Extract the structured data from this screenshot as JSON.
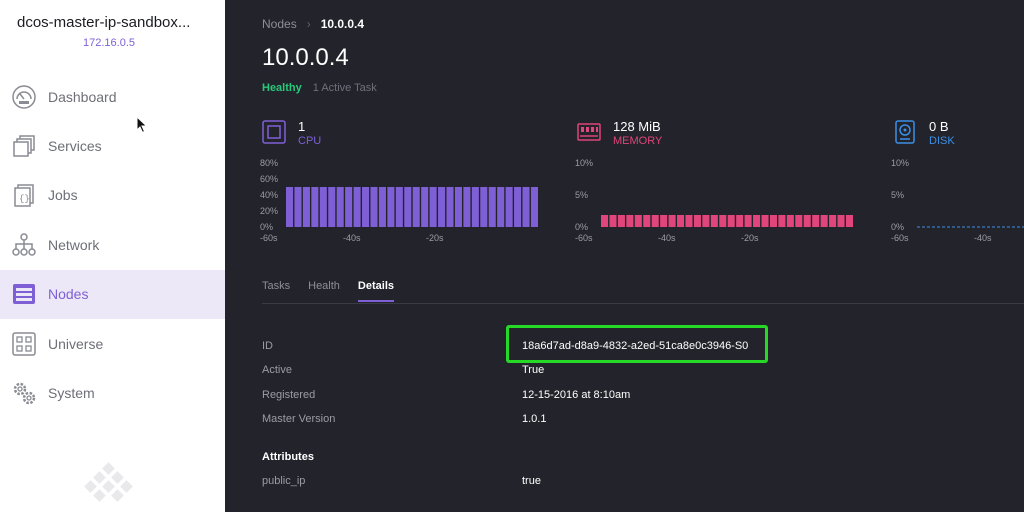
{
  "sidebar": {
    "cluster_name": "dcos-master-ip-sandbox...",
    "cluster_ip": "172.16.0.5",
    "items": [
      {
        "label": "Dashboard",
        "icon": "dashboard-icon"
      },
      {
        "label": "Services",
        "icon": "services-icon"
      },
      {
        "label": "Jobs",
        "icon": "jobs-icon"
      },
      {
        "label": "Network",
        "icon": "network-icon"
      },
      {
        "label": "Nodes",
        "icon": "nodes-icon",
        "active": true
      },
      {
        "label": "Universe",
        "icon": "universe-icon"
      },
      {
        "label": "System",
        "icon": "system-icon"
      }
    ]
  },
  "header": {
    "breadcrumb": [
      "Nodes",
      "10.0.0.4"
    ],
    "title": "10.0.0.4",
    "status": "Healthy",
    "tasks": "1 Active Task"
  },
  "metrics": [
    {
      "value": "1",
      "unit": "CPU",
      "color": "#7f5fd6",
      "y_ticks": [
        "80%",
        "60%",
        "40%",
        "20%",
        "0%"
      ],
      "x_ticks": [
        "-60s",
        "-40s",
        "-20s"
      ],
      "bar_level_percent": 50,
      "ylim": [
        0,
        80
      ]
    },
    {
      "value": "128 MiB",
      "unit": "MEMORY",
      "color": "#e0457b",
      "y_ticks": [
        "10%",
        "5%",
        "0%"
      ],
      "x_ticks": [
        "-60s",
        "-40s",
        "-20s"
      ],
      "bar_level_percent": 1.2,
      "ylim": [
        0,
        10
      ]
    },
    {
      "value": "0 B",
      "unit": "DISK",
      "color": "#3a8ee6",
      "y_ticks": [
        "10%",
        "5%",
        "0%"
      ],
      "x_ticks": [
        "-60s",
        "-40s"
      ],
      "bar_level_percent": 0,
      "ylim": [
        0,
        10
      ]
    }
  ],
  "tabs": [
    "Tasks",
    "Health",
    "Details"
  ],
  "active_tab": "Details",
  "details": {
    "rows": [
      {
        "label": "ID",
        "value": "18a6d7ad-d8a9-4832-a2ed-51ca8e0c3946-S0"
      },
      {
        "label": "Active",
        "value": "True"
      },
      {
        "label": "Registered",
        "value": "12-15-2016 at 8:10am"
      },
      {
        "label": "Master Version",
        "value": "1.0.1"
      }
    ],
    "attributes_title": "Attributes",
    "attributes": [
      {
        "label": "public_ip",
        "value": "true"
      }
    ]
  },
  "colors": {
    "accent": "#7f5fd6",
    "healthy": "#27c97b",
    "highlight": "#27d927",
    "background": "#23242b"
  }
}
